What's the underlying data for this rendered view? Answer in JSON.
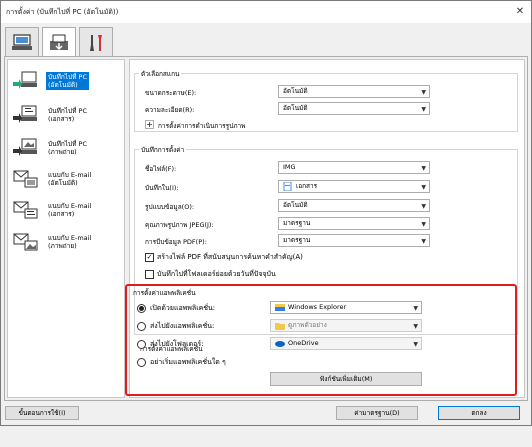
{
  "window": {
    "title": "การตั้งค่า (บันทึกไปที่ PC (อัตโนมัติ))",
    "close_glyph": "✕"
  },
  "tabs": [
    {
      "icon": "scan-from-computer-icon"
    },
    {
      "icon": "scan-from-operation-panel-icon"
    },
    {
      "icon": "general-settings-icon"
    }
  ],
  "sidebar": {
    "items": [
      {
        "label": "บันทึกไปที่ PC\n(อัตโนมัติ)",
        "icon": "auto-scan-icon",
        "selected": true
      },
      {
        "label": "บันทึกไปที่ PC\n(เอกสาร)",
        "icon": "document-scan-icon",
        "selected": false
      },
      {
        "label": "บันทึกไปที่ PC\n(ภาพถ่าย)",
        "icon": "photo-scan-icon",
        "selected": false
      },
      {
        "label": "แนบกับ E-mail\n(อัตโนมัติ)",
        "icon": "email-auto-icon",
        "selected": false
      },
      {
        "label": "แนบกับ E-mail\n(เอกสาร)",
        "icon": "email-document-icon",
        "selected": false
      },
      {
        "label": "แนบกับ E-mail\n(ภาพถ่าย)",
        "icon": "email-photo-icon",
        "selected": false
      }
    ]
  },
  "scan_options": {
    "title": "ตัวเลือกสแกน",
    "paper_size_label": "ขนาดกระดาษ(E):",
    "paper_size_value": "อัตโนมัติ",
    "resolution_label": "ความละเอียด(R):",
    "resolution_value": "อัตโนมัติ",
    "image_processing_label": "การตั้งค่าการดำเนินการรูปภาพ"
  },
  "save_settings": {
    "title": "บันทึกการตั้งค่า",
    "file_name_label": "ชื่อไฟล์(F):",
    "file_name_value": "IMG",
    "save_in_label": "บันทึกใน(I):",
    "save_in_value": "เอกสาร",
    "data_format_label": "รูปแบบข้อมูล(O):",
    "data_format_value": "อัตโนมัติ",
    "jpeg_quality_label": "คุณภาพรูปภาพ JPEG(J):",
    "jpeg_quality_value": "มาตรฐาน",
    "pdf_compression_label": "การบีบข้อมูล PDF(P):",
    "pdf_compression_value": "มาตรฐาน",
    "searchable_pdf_label": "สร้างไฟล์ PDF ที่สนับสนุนการค้นหาคำสำคัญ(A)",
    "searchable_pdf_checked": true,
    "subfolder_label": "บันทึกไปที่โฟลเดอร์ย่อยด้วยวันที่ปัจจุบัน",
    "subfolder_checked": false
  },
  "app_settings": {
    "title": "การตั้งค่าแอพพลิเคชั่น",
    "options": [
      {
        "label": "เปิดด้วยแอพพลิเคชั่น:",
        "value": "Windows Explorer",
        "icon": "explorer-icon",
        "selected": true,
        "enabled": true
      },
      {
        "label": "ส่งไปยังแอพพลิเคชั่น:",
        "value": "ดูภาพตัวอย่าง",
        "icon": "folder-icon",
        "selected": false,
        "enabled": false
      },
      {
        "label": "ส่งไปยังโฟลเดอร์:",
        "value": "OneDrive",
        "icon": "onedrive-icon",
        "selected": false,
        "enabled": false
      },
      {
        "label": "อย่าเริ่มแอพพลิเคชั่นใด ๆ",
        "selected": false
      }
    ],
    "more_functions_label": "ฟังก์ชันเพิ่มเติม(M)"
  },
  "footer": {
    "instructions_label": "ขั้นตอนการใช้(I)",
    "defaults_label": "ค่ามาตรฐาน(D)",
    "ok_label": "ตกลง"
  },
  "colors": {
    "accent": "#0078d7",
    "highlight": "#e41b1b"
  }
}
